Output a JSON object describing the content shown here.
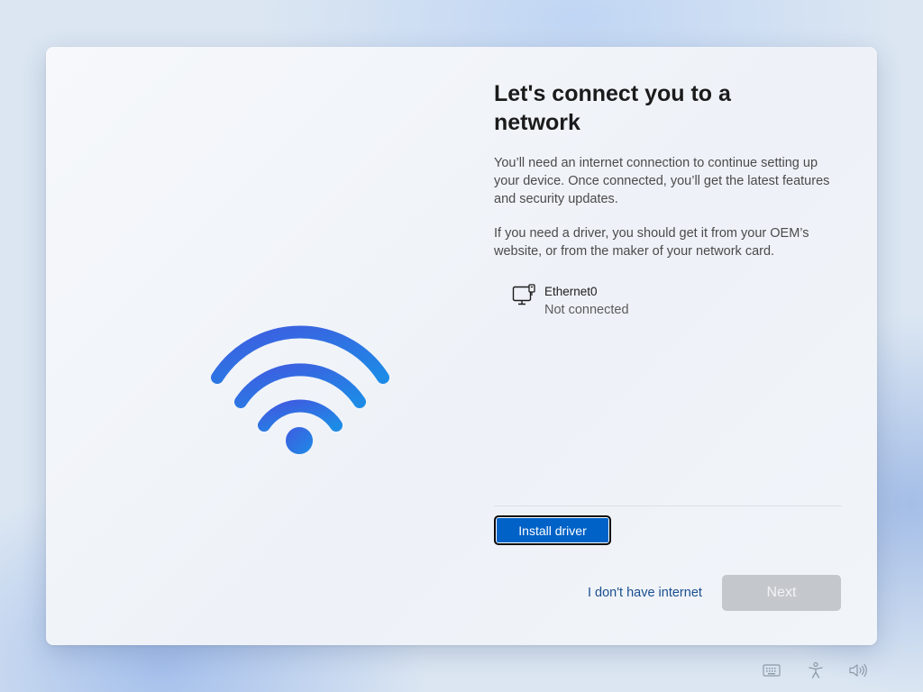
{
  "illustration": {
    "icon": "wifi-icon",
    "gradient_start": "#3f5be0",
    "gradient_end": "#1d8be6"
  },
  "setup": {
    "title": "Let's connect you to a network",
    "description": "You’ll need an internet connection to continue setting up your device. Once connected, you’ll get the latest features and security updates.",
    "driver_hint": "If you need a driver, you should get it from your OEM’s website, or from the maker of your network card."
  },
  "networks": [
    {
      "name": "Ethernet0",
      "status": "Not connected",
      "icon": "ethernet-monitor-icon"
    }
  ],
  "actions": {
    "install_driver": "Install driver",
    "no_internet": "I don't have internet",
    "next": "Next",
    "next_enabled": false
  },
  "tray": {
    "icons": [
      "keyboard-icon",
      "accessibility-icon",
      "volume-icon"
    ]
  },
  "colors": {
    "accent": "#0062c7",
    "link": "#1a4f8f",
    "disabled_button": "#c4c7cc"
  }
}
